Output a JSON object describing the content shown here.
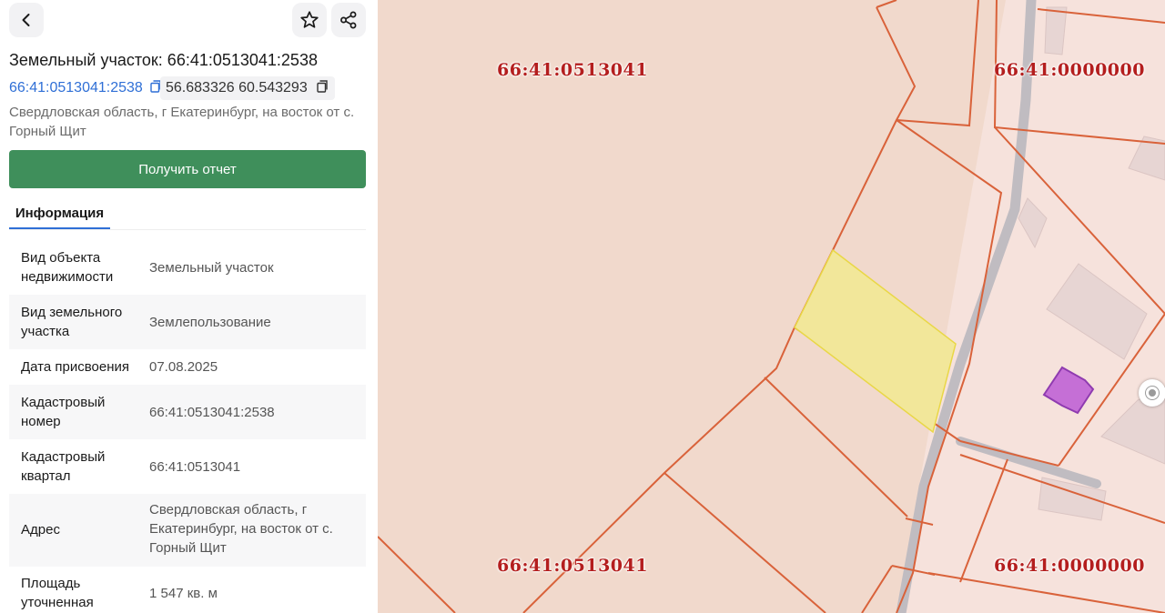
{
  "header": {
    "back_icon": "chevron-left-icon",
    "favorite_icon": "star-outline-icon",
    "share_icon": "share-icon",
    "title": "Земельный участок: 66:41:0513041:2538"
  },
  "chips": {
    "cadastral_number": "66:41:0513041:2538",
    "coordinates": "56.683326 60.543293",
    "copy_icon": "copy-icon"
  },
  "address_line": "Свердловская область, г Екатеринбург, на восток от с. Горный Щит",
  "report_button_label": "Получить отчет",
  "tabs": [
    {
      "label": "Информация",
      "active": true
    }
  ],
  "info": [
    {
      "key": "Вид объекта недвижимости",
      "value": "Земельный участок"
    },
    {
      "key": "Вид земельного участка",
      "value": "Землепользование"
    },
    {
      "key": "Дата присвоения",
      "value": "07.08.2025"
    },
    {
      "key": "Кадастровый номер",
      "value": "66:41:0513041:2538"
    },
    {
      "key": "Кадастровый квартал",
      "value": "66:41:0513041"
    },
    {
      "key": "Адрес",
      "value": "Свердловская область, г Екатеринбург, на восток от с. Горный Щит"
    },
    {
      "key": "Площадь уточненная",
      "value": "1 547 кв. м"
    }
  ],
  "map": {
    "labels": {
      "quarter_top_left": "66:41:0513041",
      "quarter_top_right": "66:41:0000000",
      "quarter_bottom_left": "66:41:0513041",
      "quarter_bottom_right": "66:41:0000000"
    },
    "colors": {
      "background": "#f1d9cc",
      "parcel_border": "#d9623a",
      "selected_parcel": "#f2e79a",
      "road": "#c0bcc1",
      "purple_object": "#c56fd6",
      "label": "#b41e1e",
      "accent": "#2f6fd6",
      "button": "#3f8f5b"
    },
    "pin_icon": "location-pin-icon"
  }
}
